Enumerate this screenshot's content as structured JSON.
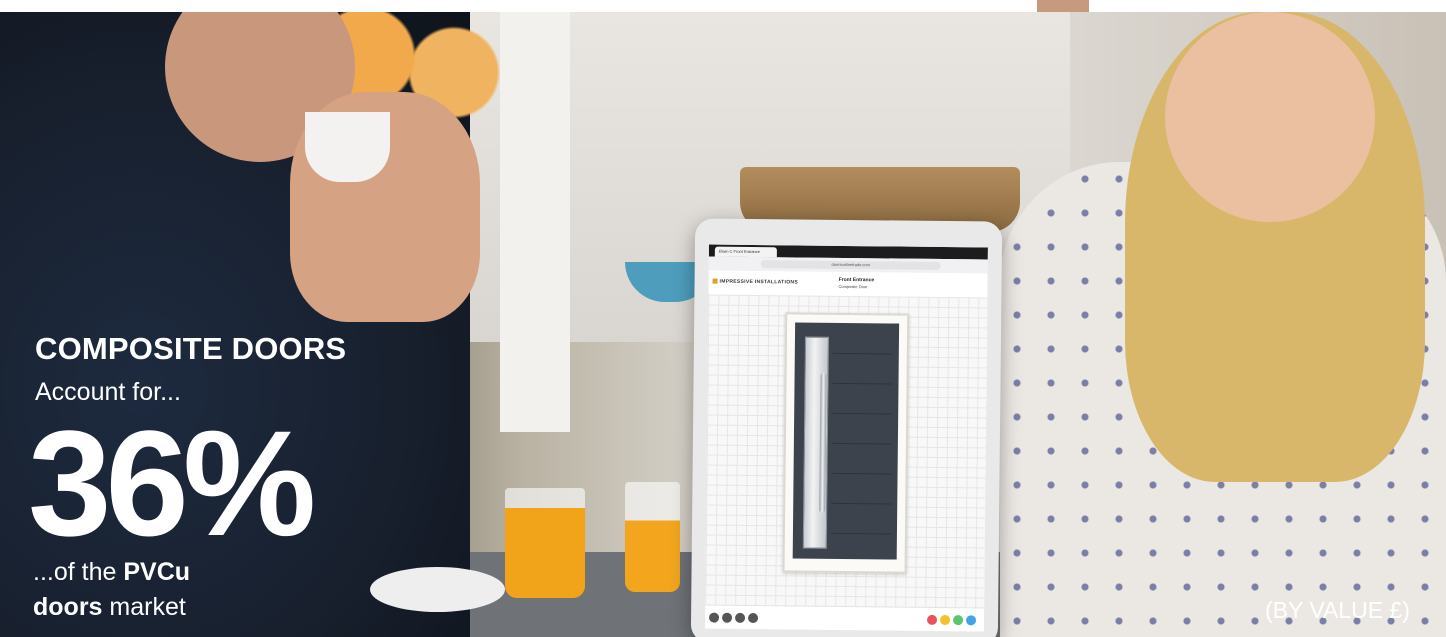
{
  "banner": {
    "headline": "COMPOSITE DOORS",
    "subline": "Account for...",
    "percent": "36%",
    "tail_prefix": "...of the ",
    "tail_bold": "PVCu",
    "tail_line2_bold": "doors",
    "tail_line2_rest": " market",
    "note": "(BY VALUE £)"
  },
  "tablet": {
    "tab_label": "Elwin C Front Entrance",
    "url": "doorsonlinetrade.com",
    "logo": "IMPRESSIVE INSTALLATIONS",
    "product_title": "Front Entrance",
    "product_sub": "Composite Door"
  },
  "colors": {
    "text": "#ffffff",
    "door": "#3c434d",
    "tool_dots": [
      "#e8545a",
      "#f4c12b",
      "#5cc46b",
      "#3fa3e8"
    ]
  }
}
